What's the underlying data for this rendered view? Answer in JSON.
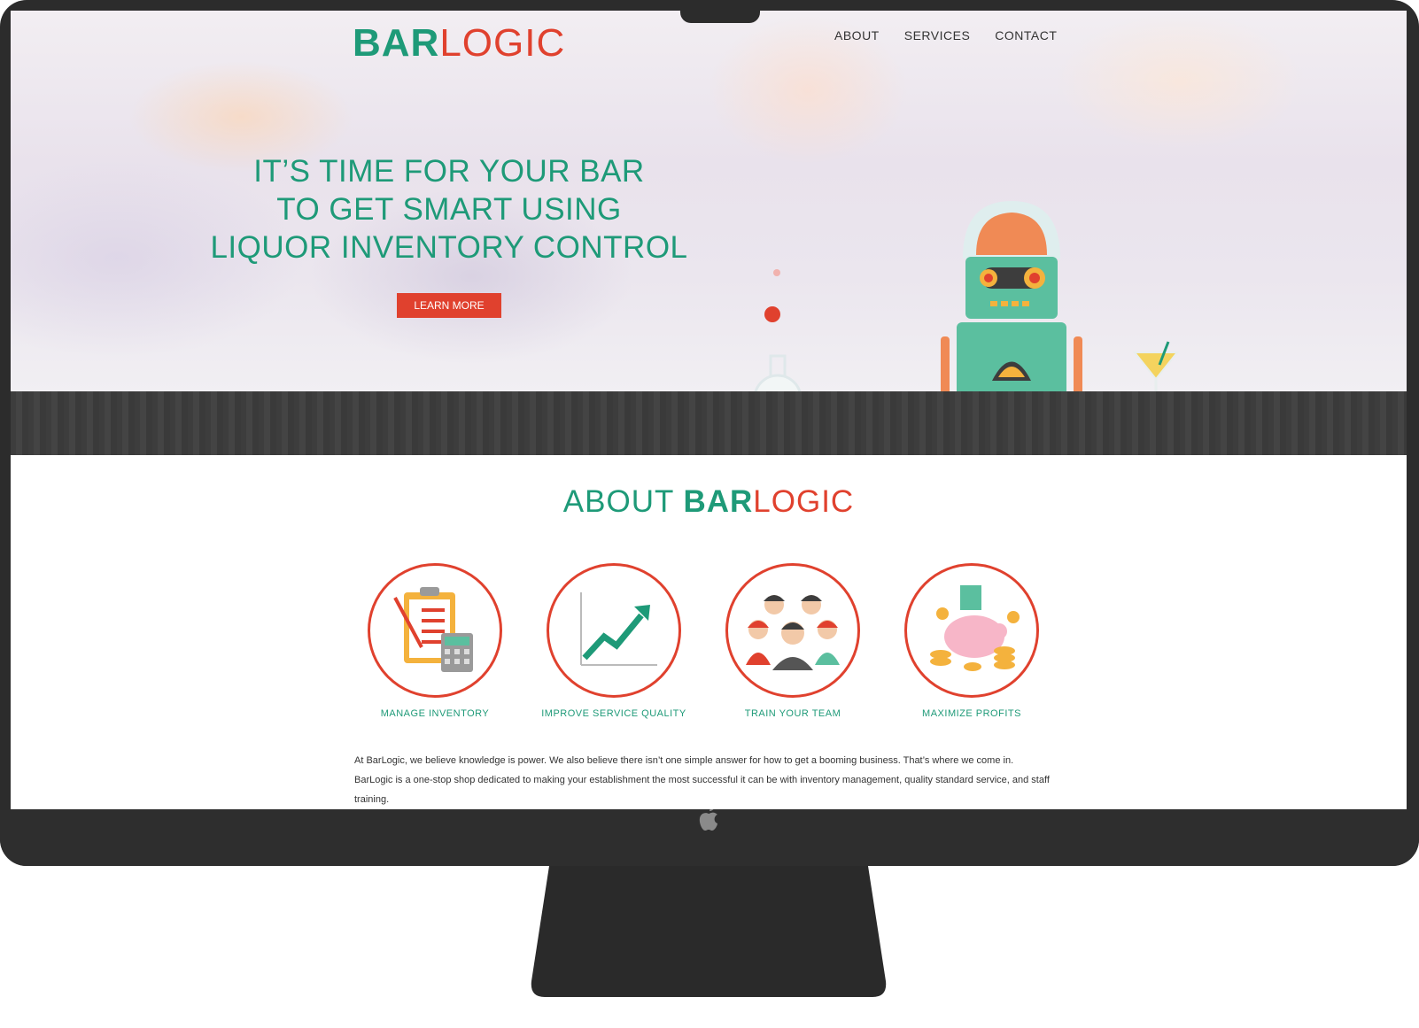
{
  "header": {
    "logo_bar": "BAR",
    "logo_logic": "LOGIC"
  },
  "nav": {
    "items": [
      "ABOUT",
      "SERVICES",
      "CONTACT"
    ]
  },
  "hero": {
    "headline_lines": [
      "IT’S TIME FOR YOUR BAR",
      "TO GET SMART USING",
      "LIQUOR INVENTORY CONTROL"
    ],
    "cta_label": "LEARN MORE"
  },
  "about": {
    "title_pre": "ABOUT ",
    "title_bar": "BAR",
    "title_logic": "LOGIC",
    "features": [
      {
        "label": "MANAGE INVENTORY",
        "icon": "clipboard-icon"
      },
      {
        "label": "IMPROVE SERVICE QUALITY",
        "icon": "growth-chart-icon"
      },
      {
        "label": "TRAIN YOUR TEAM",
        "icon": "team-icon"
      },
      {
        "label": "MAXIMIZE PROFITS",
        "icon": "piggy-bank-icon"
      }
    ],
    "paragraph": "At BarLogic, we believe knowledge is power. We also believe there isn’t one simple answer for how to get a booming business. That’s where we come in. BarLogic is a one-stop shop dedicated to making your establishment the most successful it can be with inventory management, quality standard service, and staff training."
  },
  "colors": {
    "green": "#1e9a78",
    "red": "#e0412e",
    "bezel": "#2c2c2c"
  }
}
